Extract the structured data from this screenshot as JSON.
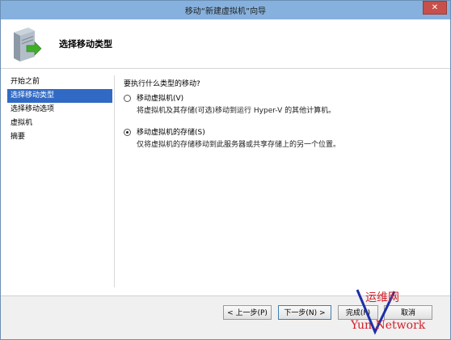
{
  "window": {
    "title": "移动“新建虚拟机”向导",
    "close_label": "✕"
  },
  "header": {
    "title": "选择移动类型",
    "icon": "server-icon"
  },
  "nav": {
    "items": [
      {
        "label": "开始之前"
      },
      {
        "label": "选择移动类型",
        "selected": true
      },
      {
        "label": "选择移动选项"
      },
      {
        "label": "虚拟机"
      },
      {
        "label": "摘要"
      }
    ]
  },
  "main": {
    "question": "要执行什么类型的移动?",
    "options": [
      {
        "label": "移动虚拟机(V)",
        "desc": "将虚拟机及其存储(可选)移动到运行 Hyper-V 的其他计算机。",
        "checked": false
      },
      {
        "label": "移动虚拟机的存储(S)",
        "desc": "仅将虚拟机的存储移动到此服务器或共享存储上的另一个位置。",
        "checked": true
      }
    ]
  },
  "buttons": {
    "prev": "< 上一步(P)",
    "next": "下一步(N) >",
    "finish": "完成(F)",
    "cancel": "取消"
  },
  "watermark": {
    "line1": "运维网",
    "line2": "Yun Network"
  },
  "colors": {
    "titlebar": "#86b1de",
    "selected": "#316ac5",
    "watermark_red": "#d21f2b",
    "watermark_blue": "#1c2ea8"
  }
}
